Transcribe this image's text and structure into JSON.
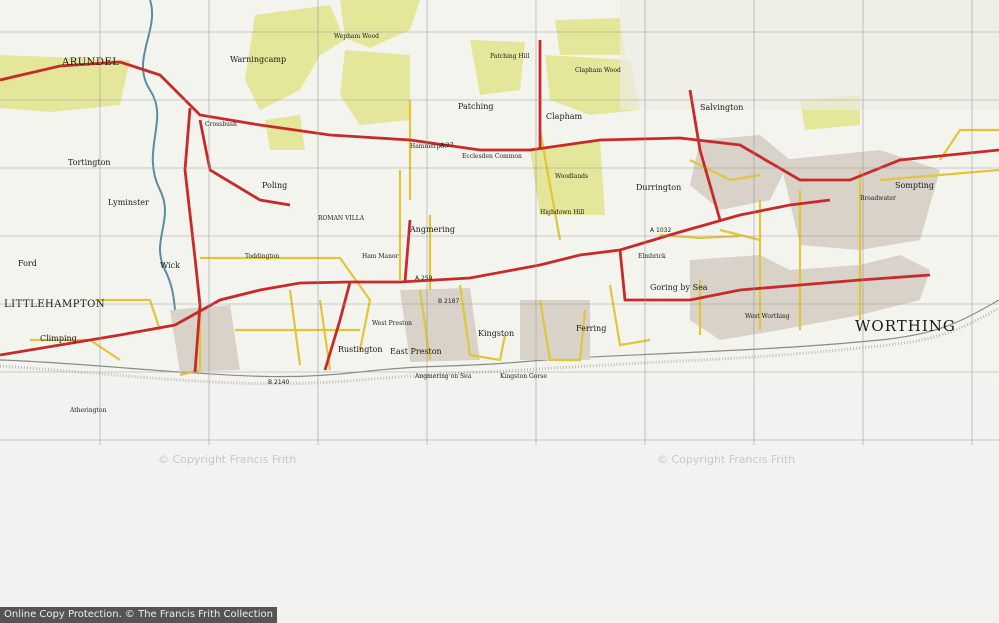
{
  "map": {
    "colors": {
      "paper": "#f4f4ef",
      "woodland": "#e4e79a",
      "main_road": "#c82a2a",
      "minor_road": "#e3c53a",
      "grid": "#9a9a9a",
      "sea": "#f2f2f0"
    },
    "towns": {
      "worthing": "WORTHING",
      "littlehampton": "LITTLEHAMPTON",
      "arundel": "ARUNDEL"
    },
    "villages": {
      "angmering": "Angmering",
      "patching": "Patching",
      "clapham": "Clapham",
      "lyminster": "Lyminster",
      "wick": "Wick",
      "ford": "Ford",
      "climping": "Climping",
      "poling": "Poling",
      "warningcamp": "Warningcamp",
      "ferring": "Ferring",
      "kingston": "Kingston",
      "rustington": "Rustington",
      "goring_by_sea": "Goring by Sea",
      "durrington": "Durrington",
      "sompting": "Sompting",
      "salvington": "Salvington",
      "tortington": "Tortington",
      "east_preston": "East Preston",
      "west_preston": "West Preston",
      "angmering_on_sea": "Angmering on Sea",
      "kingston_gorse": "Kingston Gorse",
      "west_worthing": "West Worthing",
      "hammerpot": "Hammerpot",
      "ecclesden_common": "Ecclesden Common",
      "woodlands": "Woodlands",
      "clapham_wood": "Clapham Wood",
      "highdown_hill": "Highdown Hill",
      "roman_villa": "ROMAN VILLA",
      "toddington": "Toddington",
      "elmbrick": "Elmbrick",
      "broadwater": "Broadwater",
      "crossbush": "Crossbush",
      "wepham_wood": "Wepham Wood",
      "patching_hill": "Patching Hill",
      "atherington": "Atherington",
      "ham_manor": "Ham Manor"
    },
    "roads": {
      "a27": "A 27",
      "a259": "A 259",
      "a1032": "A 1032",
      "b2140": "B 2140",
      "b2187": "B 2187"
    },
    "copyright_left": "© Copyright Francis Frith",
    "copyright_right": "© Copyright Francis Frith"
  },
  "footer": {
    "text": "Online Copy Protection. © The Francis Frith Collection"
  }
}
